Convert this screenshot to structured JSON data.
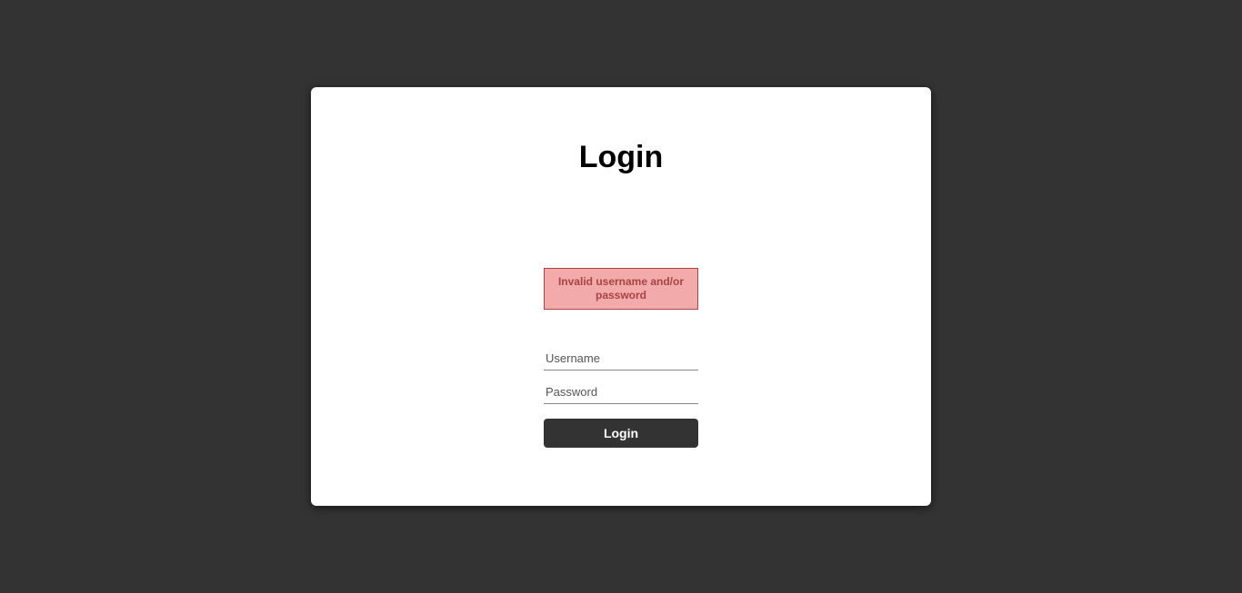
{
  "login": {
    "title": "Login",
    "error_message": "Invalid username and/or password",
    "username": {
      "placeholder": "Username",
      "value": ""
    },
    "password": {
      "placeholder": "Password",
      "value": ""
    },
    "submit_label": "Login"
  }
}
